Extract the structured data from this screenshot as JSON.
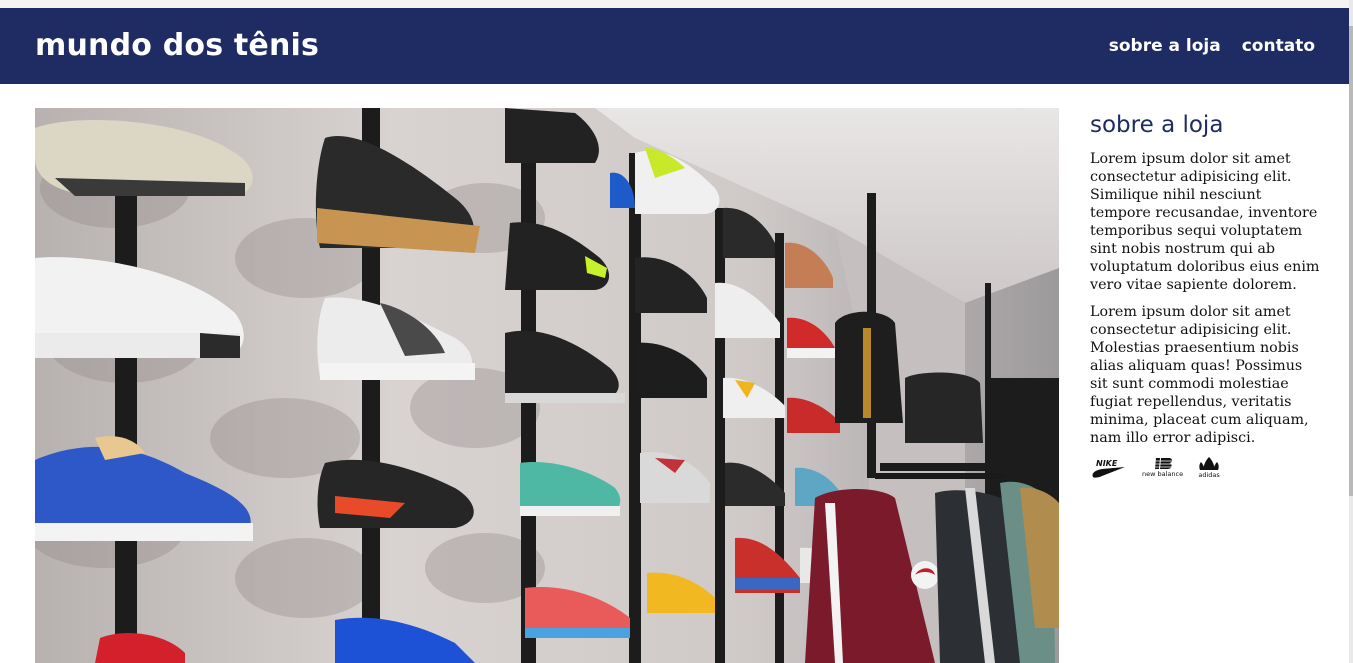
{
  "header": {
    "logo": "mundo dos tênis",
    "nav": [
      "sobre a loja",
      "contato"
    ]
  },
  "aside": {
    "title": "sobre a loja",
    "paragraphs": [
      "Lorem ipsum dolor sit amet consectetur adipisicing elit. Similique nihil nesciunt tempore recusandae, inventore temporibus sequi voluptatem sint nobis nostrum qui ab voluptatum doloribus eius enim vero vitae sapiente dolorem.",
      "Lorem ipsum dolor sit amet consectetur adipisicing elit. Molestias praesentium nobis alias aliquam quas! Possimus sit sunt commodi molestiae fugiat repellendus, veritatis minima, placeat cum aliquam, nam illo error adipisci."
    ],
    "brands": [
      "NIKE",
      "new balance",
      "adidas"
    ]
  },
  "colors": {
    "header_bg": "#1e2c63",
    "heading": "#1e2c63"
  },
  "icons": {
    "photo": "sneaker-store-photo",
    "brand_logos": [
      "nike-logo-icon",
      "new-balance-logo-icon",
      "adidas-logo-icon"
    ]
  }
}
